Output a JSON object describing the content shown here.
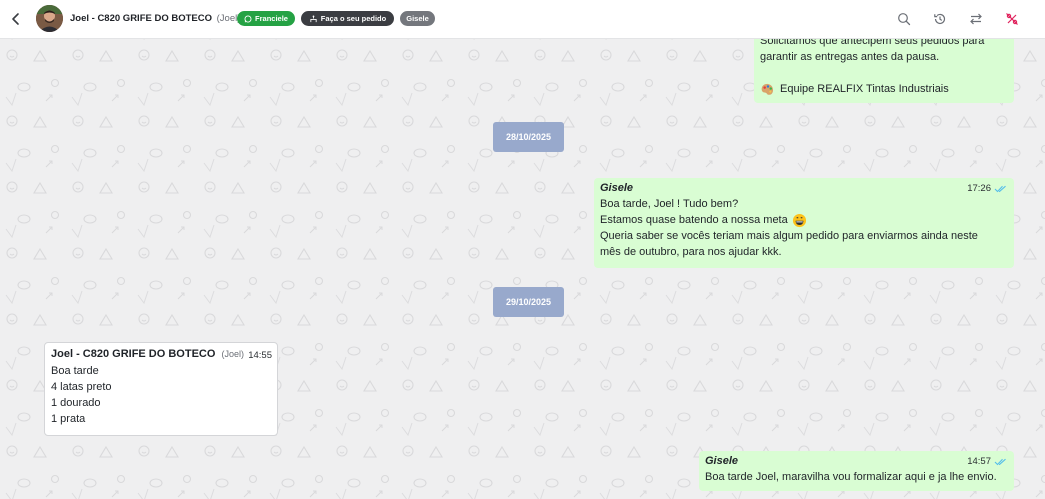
{
  "header": {
    "contact_name": "Joel - C820 GRIFE DO BOTECO",
    "contact_nick": "(Joel)",
    "agent_chip": "Franciele",
    "order_chip": "Faça o seu pedido",
    "user_chip": "Gisele",
    "colors": {
      "agent_chip": "#25a244",
      "order_chip": "#3b3d42",
      "user_chip": "#74777d",
      "alert_icon": "#e0245e"
    },
    "icons": [
      "back-arrow-icon",
      "search-icon",
      "history-icon",
      "transfer-icon",
      "percent-off-icon"
    ]
  },
  "messages": {
    "top_partial": {
      "line1": "Solicitamos que antecipem seus pedidos para",
      "line2": "garantir as entregas antes da pausa.",
      "signature": "Equipe REALFIX Tintas Industriais"
    },
    "date1": "28/10/2025",
    "msg_gisele_1": {
      "sender": "Gisele",
      "time": "17:26",
      "line1": "Boa tarde, Joel ! Tudo bem?",
      "line2": "Estamos quase batendo a nossa meta",
      "line3": "Queria saber se vocês teriam mais algum pedido para enviarmos ainda neste",
      "line4": "mês de outubro, para nos ajudar kkk."
    },
    "date2": "29/10/2025",
    "msg_joel": {
      "sender": "Joel - C820 GRIFE DO BOTECO",
      "nick": "(Joel)",
      "time": "14:55",
      "lines": [
        "Boa tarde",
        "4 latas preto",
        "1 dourado",
        "1 prata"
      ]
    },
    "msg_gisele_2": {
      "sender": "Gisele",
      "time": "14:57",
      "text": "Boa tarde Joel, maravilha vou formalizar aqui e ja lhe envio."
    }
  },
  "colors": {
    "outgoing_bubble": "#d9fdd3",
    "incoming_bubble": "#ffffff",
    "date_pill": "#98a9cc",
    "read_ticks": "#53bdeb",
    "chat_bg": "#efeff0"
  }
}
